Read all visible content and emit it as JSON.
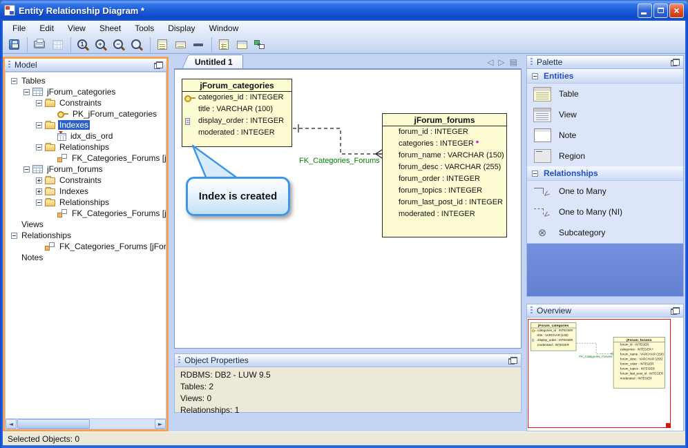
{
  "window": {
    "title": "Entity Relationship Diagram *"
  },
  "menu": {
    "items": [
      "File",
      "Edit",
      "View",
      "Sheet",
      "Tools",
      "Display",
      "Window"
    ]
  },
  "toolbar": {
    "buttons": [
      {
        "button": "save-button",
        "icon": "save-icon"
      },
      {
        "button": "print-button",
        "icon": "print-icon",
        "sep_before": true
      },
      {
        "button": "grid-button",
        "icon": "grid-icon"
      },
      {
        "button": "zoom-actual-button",
        "icon": "zoom-actual-icon",
        "glyph": "1",
        "sep_before": true
      },
      {
        "button": "zoom-in-button",
        "icon": "zoom-in-icon",
        "glyph": "+"
      },
      {
        "button": "zoom-out-button",
        "icon": "zoom-out-icon",
        "glyph": "−"
      },
      {
        "button": "zoom-tool-button",
        "icon": "zoom-icon",
        "glyph": ""
      },
      {
        "button": "view-detailed-button",
        "icon": "view-detailed-icon",
        "sep_before": true
      },
      {
        "button": "view-compact-button",
        "icon": "view-compact-icon"
      },
      {
        "button": "view-minimal-button",
        "icon": "view-minimal-icon"
      },
      {
        "button": "show-columns-button",
        "icon": "show-columns-icon",
        "sep_before": true
      },
      {
        "button": "show-entity-button",
        "icon": "show-entity-icon"
      },
      {
        "button": "auto-layout-button",
        "icon": "auto-layout-icon"
      }
    ]
  },
  "model_panel": {
    "title": "Model",
    "tree": [
      {
        "level": 0,
        "exp": "minus",
        "icon": "",
        "label": "Tables"
      },
      {
        "level": 1,
        "exp": "minus",
        "icon": "table-icon",
        "label": "jForum_categories"
      },
      {
        "level": 2,
        "exp": "minus",
        "icon": "folder-icon",
        "label": "Constraints"
      },
      {
        "level": 3,
        "exp": "none",
        "icon": "key-icon",
        "label": "PK_jForum_categories"
      },
      {
        "level": 2,
        "exp": "minus",
        "icon": "folder-icon",
        "label": "Indexes",
        "selected": true
      },
      {
        "level": 3,
        "exp": "none",
        "icon": "index-icon",
        "label": "idx_dis_ord"
      },
      {
        "level": 2,
        "exp": "minus",
        "icon": "folder-icon",
        "label": "Relationships"
      },
      {
        "level": 3,
        "exp": "none",
        "icon": "fk-icon",
        "label": "FK_Categories_Forums [jFo"
      },
      {
        "level": 1,
        "exp": "minus",
        "icon": "table-icon",
        "label": "jForum_forums"
      },
      {
        "level": 2,
        "exp": "plus",
        "icon": "folder-closed-icon",
        "label": "Constraints"
      },
      {
        "level": 2,
        "exp": "plus",
        "icon": "folder-closed-icon",
        "label": "Indexes"
      },
      {
        "level": 2,
        "exp": "minus",
        "icon": "folder-icon",
        "label": "Relationships"
      },
      {
        "level": 3,
        "exp": "none",
        "icon": "fk-icon",
        "label": "FK_Categories_Forums [jFo"
      },
      {
        "level": 0,
        "exp": "none",
        "icon": "",
        "label": "Views"
      },
      {
        "level": 0,
        "exp": "minus",
        "icon": "",
        "label": "Relationships"
      },
      {
        "level": 2,
        "exp": "none",
        "icon": "fk-icon",
        "label": "FK_Categories_Forums [jForum_ca"
      },
      {
        "level": 0,
        "exp": "none",
        "icon": "",
        "label": "Notes"
      }
    ]
  },
  "canvas": {
    "tab": "Untitled 1",
    "relationship_label": "FK_Categories_Forums",
    "callout_text": "Index is created",
    "tables": [
      {
        "name": "jForum_categories",
        "columns": [
          {
            "icon": "key-icon",
            "text": "categories_id : INTEGER",
            "star": ""
          },
          {
            "icon": "",
            "text": "title : VARCHAR (100)",
            "star": ""
          },
          {
            "icon": "attr-index-icon",
            "text": "display_order : INTEGER",
            "star": ""
          },
          {
            "icon": "",
            "text": "moderated : INTEGER",
            "star": ""
          }
        ]
      },
      {
        "name": "jForum_forums",
        "columns": [
          {
            "icon": "",
            "text": "forum_id : INTEGER",
            "star": ""
          },
          {
            "icon": "",
            "text": "categories : INTEGER",
            "star": "*"
          },
          {
            "icon": "",
            "text": "forum_name : VARCHAR (150)",
            "star": ""
          },
          {
            "icon": "",
            "text": "forum_desc : VARCHAR (255)",
            "star": ""
          },
          {
            "icon": "",
            "text": "forum_order : INTEGER",
            "star": ""
          },
          {
            "icon": "",
            "text": "forum_topics : INTEGER",
            "star": ""
          },
          {
            "icon": "",
            "text": "forum_last_post_id : INTEGER",
            "star": ""
          },
          {
            "icon": "",
            "text": "moderated : INTEGER",
            "star": ""
          }
        ]
      }
    ]
  },
  "palette": {
    "title": "Palette",
    "entities": {
      "label": "Entities",
      "items": [
        {
          "thumb": "table-thumb",
          "label": "Table"
        },
        {
          "thumb": "view-thumb",
          "label": "View"
        },
        {
          "thumb": "note-thumb",
          "label": "Note"
        },
        {
          "thumb": "region-thumb",
          "label": "Region"
        }
      ]
    },
    "relationships": {
      "label": "Relationships",
      "items": [
        {
          "thumb": "one-to-many-thumb",
          "label": "One to Many"
        },
        {
          "thumb": "one-to-many-ni-thumb",
          "label": "One to Many (NI)"
        },
        {
          "thumb": "subcategory-thumb",
          "label": "Subcategory"
        }
      ]
    }
  },
  "overview": {
    "title": "Overview"
  },
  "object_properties": {
    "title": "Object Properties",
    "lines": [
      "RDBMS: DB2 - LUW 9.5",
      "Tables: 2",
      "Views: 0",
      "Relationships: 1"
    ]
  },
  "statusbar": {
    "text": "Selected Objects: 0"
  }
}
